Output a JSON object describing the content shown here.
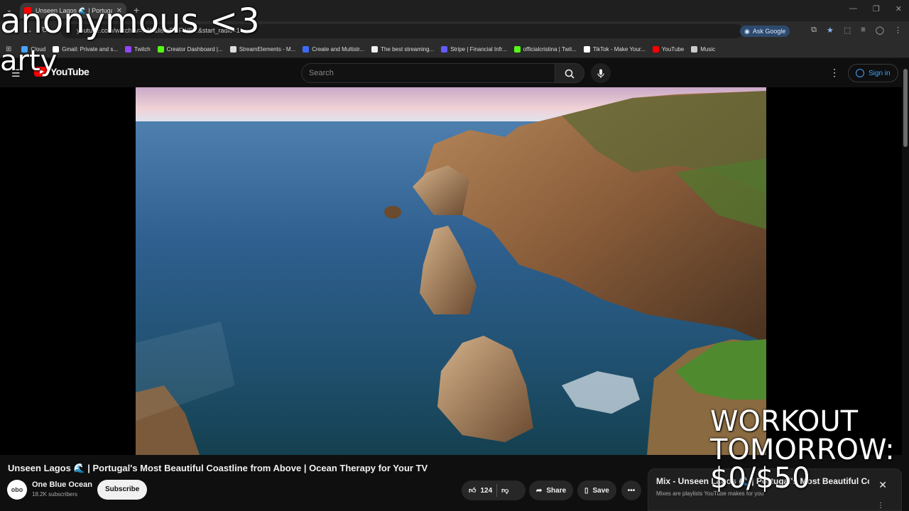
{
  "browser": {
    "tab_title": "Unseen Lagos 🌊 | Portugal's Most Beautiful Coastline from Above | Ocean Therapy for Your TV",
    "url": "youtube.com/watch?v=...W&list=RDFWS...&start_radio=1",
    "ask_google": "Ask Google",
    "bookmarks": [
      {
        "label": "Cloud",
        "color": "#4aa3ff"
      },
      {
        "label": "Gmail: Private and s...",
        "color": "#ffffff"
      },
      {
        "label": "Twitch",
        "color": "#9146ff"
      },
      {
        "label": "Creator Dashboard |...",
        "color": "#53fc18"
      },
      {
        "label": "StreamElements - M...",
        "color": "#dddddd"
      },
      {
        "label": "Create and Multistr...",
        "color": "#3d6bff"
      },
      {
        "label": "The best streaming...",
        "color": "#eeeeee"
      },
      {
        "label": "Stripe | Financial Infr...",
        "color": "#635bff"
      },
      {
        "label": "officialcristina | Twit...",
        "color": "#53fc18"
      },
      {
        "label": "TikTok - Make Your...",
        "color": "#ffffff"
      },
      {
        "label": "YouTube",
        "color": "#ff0000"
      },
      {
        "label": "Music",
        "color": "#cccccc"
      }
    ]
  },
  "youtube": {
    "logo_text": "YouTube",
    "search_placeholder": "Search",
    "sign_in": "Sign in"
  },
  "video": {
    "title": "Unseen Lagos 🌊 | Portugal's Most Beautiful Coastline from Above | Ocean Therapy for Your TV",
    "channel_name": "One Blue Ocean",
    "channel_initials": "obo",
    "subscribers": "18.2K subscribers",
    "subscribe_label": "Subscribe",
    "likes": "124",
    "share_label": "Share",
    "save_label": "Save"
  },
  "mix": {
    "title": "Mix - Unseen Lagos 🌊 | Portugal's Most Beautiful Coastline...",
    "subtitle": "Mixes are playlists YouTube makes for you"
  },
  "overlays": {
    "streamer_name": "anonymous <3",
    "streamer_sub": "arty",
    "goal_line1": "WORKOUT",
    "goal_line2": "TOMORROW:",
    "goal_line3": "$0/$50"
  },
  "colors": {
    "accent_link": "#3ea6ff",
    "brand_red": "#ff0000",
    "page_bg": "#0f0f0f"
  }
}
